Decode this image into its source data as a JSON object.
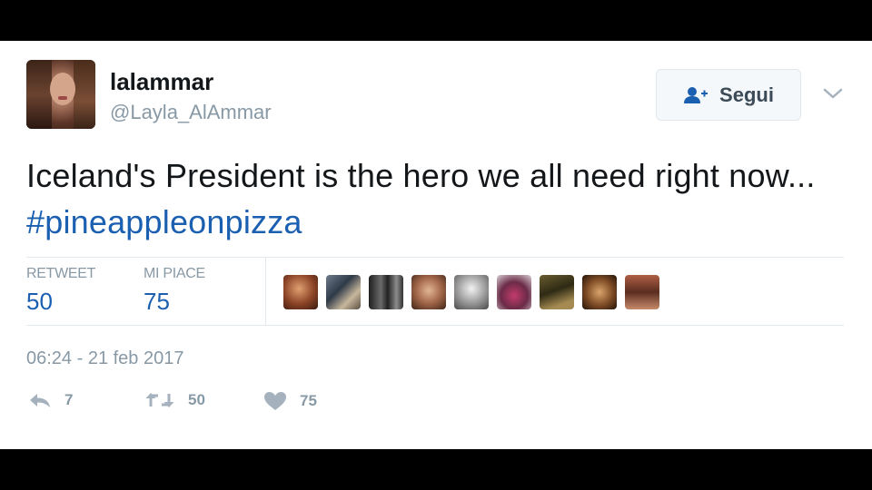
{
  "tweet": {
    "display_name": "lalammar",
    "handle": "@Layla_AlAmmar",
    "follow_label": "Segui",
    "text_prefix": "Iceland's President is the hero we all need right now... ",
    "hashtag": "#pineappleonpizza",
    "stats": {
      "retweets_label": "RETWEET",
      "retweets_value": "50",
      "likes_label": "MI PIACE",
      "likes_value": "75"
    },
    "timestamp": "06:24 - 21 feb 2017",
    "actions": {
      "reply_count": "7",
      "retweet_count": "50",
      "like_count": "75"
    }
  },
  "colors": {
    "link_blue": "#1b5fb1",
    "muted_gray": "#8899a6",
    "text_dark": "#14171a",
    "letterbox": "#000000"
  },
  "icons": {
    "follow": "person-plus-icon",
    "menu": "chevron-down-icon",
    "reply": "reply-icon",
    "retweet": "retweet-icon",
    "like": "heart-icon"
  }
}
